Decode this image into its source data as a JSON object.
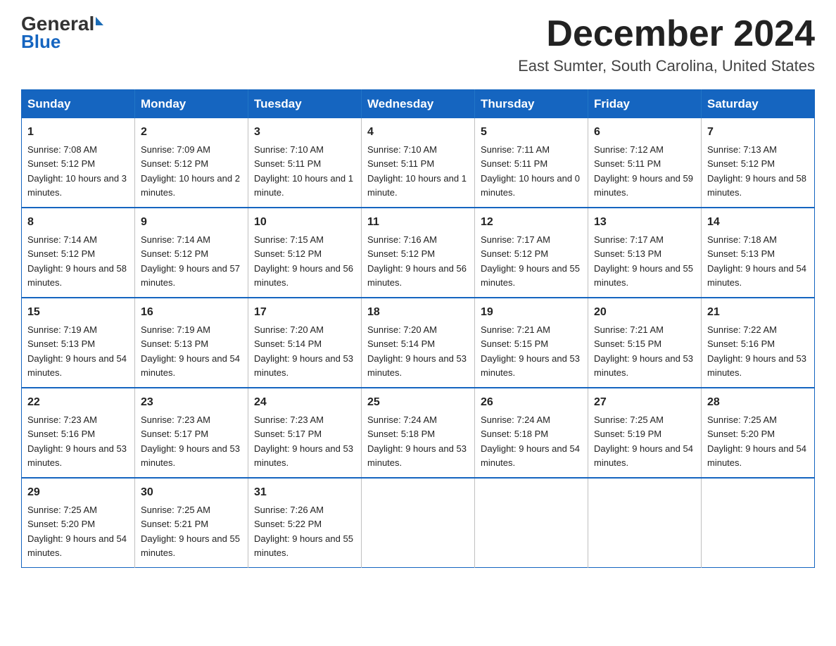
{
  "header": {
    "logo_general": "General",
    "logo_blue": "Blue",
    "month_title": "December 2024",
    "location": "East Sumter, South Carolina, United States"
  },
  "days_of_week": [
    "Sunday",
    "Monday",
    "Tuesday",
    "Wednesday",
    "Thursday",
    "Friday",
    "Saturday"
  ],
  "weeks": [
    [
      {
        "day": "1",
        "sunrise": "7:08 AM",
        "sunset": "5:12 PM",
        "daylight": "10 hours and 3 minutes."
      },
      {
        "day": "2",
        "sunrise": "7:09 AM",
        "sunset": "5:12 PM",
        "daylight": "10 hours and 2 minutes."
      },
      {
        "day": "3",
        "sunrise": "7:10 AM",
        "sunset": "5:11 PM",
        "daylight": "10 hours and 1 minute."
      },
      {
        "day": "4",
        "sunrise": "7:10 AM",
        "sunset": "5:11 PM",
        "daylight": "10 hours and 1 minute."
      },
      {
        "day": "5",
        "sunrise": "7:11 AM",
        "sunset": "5:11 PM",
        "daylight": "10 hours and 0 minutes."
      },
      {
        "day": "6",
        "sunrise": "7:12 AM",
        "sunset": "5:11 PM",
        "daylight": "9 hours and 59 minutes."
      },
      {
        "day": "7",
        "sunrise": "7:13 AM",
        "sunset": "5:12 PM",
        "daylight": "9 hours and 58 minutes."
      }
    ],
    [
      {
        "day": "8",
        "sunrise": "7:14 AM",
        "sunset": "5:12 PM",
        "daylight": "9 hours and 58 minutes."
      },
      {
        "day": "9",
        "sunrise": "7:14 AM",
        "sunset": "5:12 PM",
        "daylight": "9 hours and 57 minutes."
      },
      {
        "day": "10",
        "sunrise": "7:15 AM",
        "sunset": "5:12 PM",
        "daylight": "9 hours and 56 minutes."
      },
      {
        "day": "11",
        "sunrise": "7:16 AM",
        "sunset": "5:12 PM",
        "daylight": "9 hours and 56 minutes."
      },
      {
        "day": "12",
        "sunrise": "7:17 AM",
        "sunset": "5:12 PM",
        "daylight": "9 hours and 55 minutes."
      },
      {
        "day": "13",
        "sunrise": "7:17 AM",
        "sunset": "5:13 PM",
        "daylight": "9 hours and 55 minutes."
      },
      {
        "day": "14",
        "sunrise": "7:18 AM",
        "sunset": "5:13 PM",
        "daylight": "9 hours and 54 minutes."
      }
    ],
    [
      {
        "day": "15",
        "sunrise": "7:19 AM",
        "sunset": "5:13 PM",
        "daylight": "9 hours and 54 minutes."
      },
      {
        "day": "16",
        "sunrise": "7:19 AM",
        "sunset": "5:13 PM",
        "daylight": "9 hours and 54 minutes."
      },
      {
        "day": "17",
        "sunrise": "7:20 AM",
        "sunset": "5:14 PM",
        "daylight": "9 hours and 53 minutes."
      },
      {
        "day": "18",
        "sunrise": "7:20 AM",
        "sunset": "5:14 PM",
        "daylight": "9 hours and 53 minutes."
      },
      {
        "day": "19",
        "sunrise": "7:21 AM",
        "sunset": "5:15 PM",
        "daylight": "9 hours and 53 minutes."
      },
      {
        "day": "20",
        "sunrise": "7:21 AM",
        "sunset": "5:15 PM",
        "daylight": "9 hours and 53 minutes."
      },
      {
        "day": "21",
        "sunrise": "7:22 AM",
        "sunset": "5:16 PM",
        "daylight": "9 hours and 53 minutes."
      }
    ],
    [
      {
        "day": "22",
        "sunrise": "7:23 AM",
        "sunset": "5:16 PM",
        "daylight": "9 hours and 53 minutes."
      },
      {
        "day": "23",
        "sunrise": "7:23 AM",
        "sunset": "5:17 PM",
        "daylight": "9 hours and 53 minutes."
      },
      {
        "day": "24",
        "sunrise": "7:23 AM",
        "sunset": "5:17 PM",
        "daylight": "9 hours and 53 minutes."
      },
      {
        "day": "25",
        "sunrise": "7:24 AM",
        "sunset": "5:18 PM",
        "daylight": "9 hours and 53 minutes."
      },
      {
        "day": "26",
        "sunrise": "7:24 AM",
        "sunset": "5:18 PM",
        "daylight": "9 hours and 54 minutes."
      },
      {
        "day": "27",
        "sunrise": "7:25 AM",
        "sunset": "5:19 PM",
        "daylight": "9 hours and 54 minutes."
      },
      {
        "day": "28",
        "sunrise": "7:25 AM",
        "sunset": "5:20 PM",
        "daylight": "9 hours and 54 minutes."
      }
    ],
    [
      {
        "day": "29",
        "sunrise": "7:25 AM",
        "sunset": "5:20 PM",
        "daylight": "9 hours and 54 minutes."
      },
      {
        "day": "30",
        "sunrise": "7:25 AM",
        "sunset": "5:21 PM",
        "daylight": "9 hours and 55 minutes."
      },
      {
        "day": "31",
        "sunrise": "7:26 AM",
        "sunset": "5:22 PM",
        "daylight": "9 hours and 55 minutes."
      },
      null,
      null,
      null,
      null
    ]
  ]
}
